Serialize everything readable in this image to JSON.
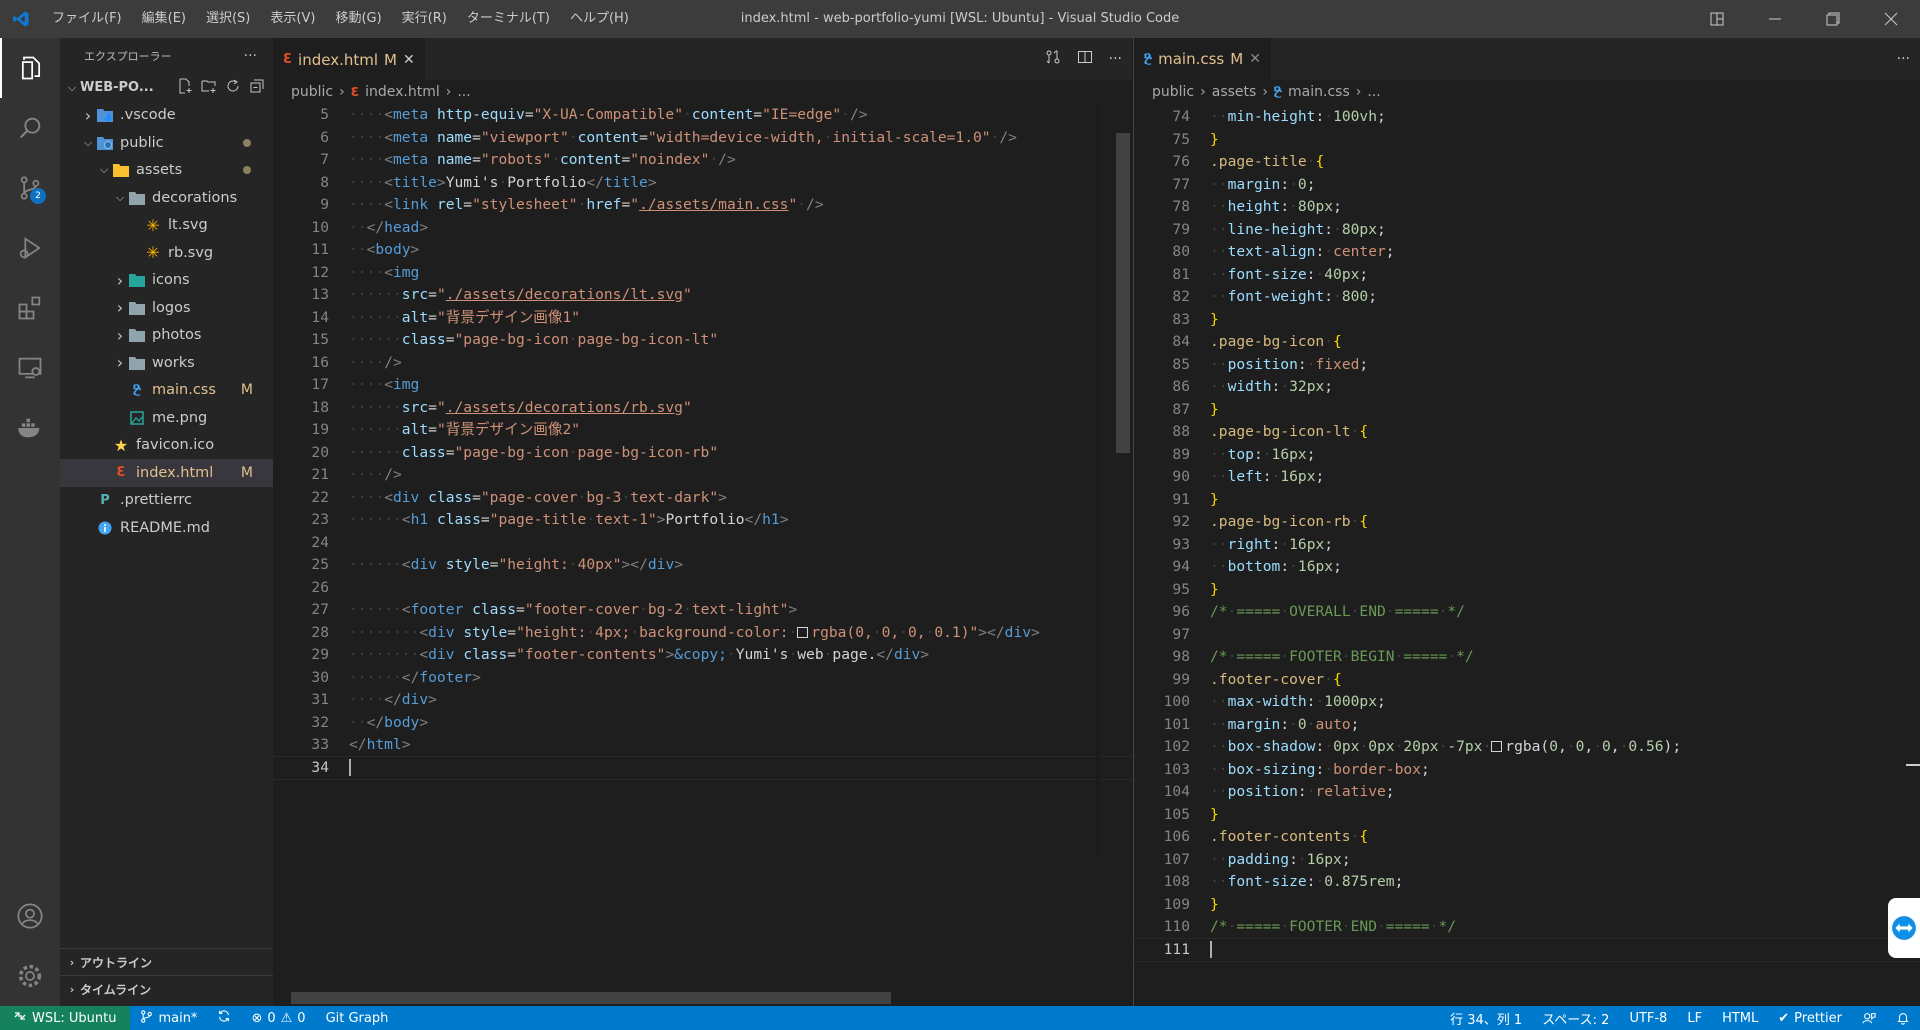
{
  "window": {
    "title": "index.html - web-portfolio-yumi [WSL: Ubuntu] - Visual Studio Code",
    "menu": [
      "ファイル(F)",
      "編集(E)",
      "選択(S)",
      "表示(V)",
      "移動(G)",
      "実行(R)",
      "ターミナル(T)",
      "ヘルプ(H)"
    ]
  },
  "activity": {
    "scm_badge": "2"
  },
  "sidebar": {
    "title": "エクスプローラー",
    "more": "···",
    "root": "WEB-PO...",
    "items": [
      {
        "label": ".vscode",
        "kind": "folder-vscode",
        "depth": 1,
        "chevron": "right"
      },
      {
        "label": "public",
        "kind": "folder-public",
        "depth": 1,
        "chevron": "down",
        "dot": true
      },
      {
        "label": "assets",
        "kind": "folder-assets",
        "depth": 2,
        "chevron": "down",
        "dot": true
      },
      {
        "label": "decorations",
        "kind": "folder",
        "depth": 3,
        "chevron": "down"
      },
      {
        "label": "lt.svg",
        "kind": "svg",
        "depth": 4
      },
      {
        "label": "rb.svg",
        "kind": "svg",
        "depth": 4
      },
      {
        "label": "icons",
        "kind": "folder-icons",
        "depth": 3,
        "chevron": "right"
      },
      {
        "label": "logos",
        "kind": "folder",
        "depth": 3,
        "chevron": "right"
      },
      {
        "label": "photos",
        "kind": "folder",
        "depth": 3,
        "chevron": "right"
      },
      {
        "label": "works",
        "kind": "folder",
        "depth": 3,
        "chevron": "right"
      },
      {
        "label": "main.css",
        "kind": "css",
        "depth": 3,
        "flag": "M"
      },
      {
        "label": "me.png",
        "kind": "png",
        "depth": 3
      },
      {
        "label": "favicon.ico",
        "kind": "ico",
        "depth": 2
      },
      {
        "label": "index.html",
        "kind": "html",
        "depth": 2,
        "flag": "M",
        "selected": true
      },
      {
        "label": ".prettierrc",
        "kind": "prettier",
        "depth": 1
      },
      {
        "label": "README.md",
        "kind": "info",
        "depth": 1
      }
    ],
    "outline": "アウトライン",
    "timeline": "タイムライン"
  },
  "left_editor": {
    "tab": {
      "name": "index.html",
      "flag": "M",
      "close": "✕"
    },
    "crumbs": [
      "public",
      "index.html",
      "..."
    ],
    "lines": [
      {
        "n": "5",
        "h": "····<t><meta</t> <a>http-equiv</a>=<s>\"X-UA-Compatible\"</s>·<a>content</a>=<s>\"IE=edge\"</s>·<t>/></t>"
      },
      {
        "n": "6",
        "h": "····<t><meta</t> <a>name</a>=<s>\"viewport\"</s>·<a>content</a>=<s>\"width=device-width,·initial-scale=1.0\"</s>·<t>/></t>"
      },
      {
        "n": "7",
        "h": "····<t><meta</t> <a>name</a>=<s>\"robots\"</s>·<a>content</a>=<s>\"noindex\"</s>·<t>/></t>"
      },
      {
        "n": "8",
        "h": "····<t><title></t>Yumi's·Portfolio<t></title></t>"
      },
      {
        "n": "9",
        "h": "····<t><link</t> <a>rel</a>=<s>\"stylesheet\"</s>·<a>href</a>=<s>\"<u>./assets/main.css</u>\"</s>·<t>/></t>"
      },
      {
        "n": "10",
        "h": "··<t></head></t>"
      },
      {
        "n": "11",
        "h": "··<t><body></t>"
      },
      {
        "n": "12",
        "h": "····<t><img</t>"
      },
      {
        "n": "13",
        "h": "······<a>src</a>=<s>\"<u>./assets/decorations/lt.svg</u>\"</s>"
      },
      {
        "n": "14",
        "h": "······<a>alt</a>=<s>\"背景デザイン画像1\"</s>"
      },
      {
        "n": "15",
        "h": "······<a>class</a>=<s>\"page-bg-icon·page-bg-icon-lt\"</s>"
      },
      {
        "n": "16",
        "h": "····<t>/></t>"
      },
      {
        "n": "17",
        "h": "····<t><img</t>"
      },
      {
        "n": "18",
        "h": "······<a>src</a>=<s>\"<u>./assets/decorations/rb.svg</u>\"</s>"
      },
      {
        "n": "19",
        "h": "······<a>alt</a>=<s>\"背景デザイン画像2\"</s>"
      },
      {
        "n": "20",
        "h": "······<a>class</a>=<s>\"page-bg-icon·page-bg-icon-rb\"</s>"
      },
      {
        "n": "21",
        "h": "····<t>/></t>"
      },
      {
        "n": "22",
        "h": "····<t><div</t> <a>class</a>=<s>\"page-cover·bg-3·text-dark\"</s><t>></t>"
      },
      {
        "n": "23",
        "h": "······<t><h1</t> <a>class</a>=<s>\"page-title·text-1\"</s><t>></t>Portfolio<t></h1></t>"
      },
      {
        "n": "24",
        "h": ""
      },
      {
        "n": "25",
        "h": "······<t><div</t> <a>style</a>=<s>\"height:·40px\"</s><t>></div></t>"
      },
      {
        "n": "26",
        "h": ""
      },
      {
        "n": "27",
        "h": "······<t><footer</t> <a>class</a>=<s>\"footer-cover·bg-2·text-light\"</s><t>></t>"
      },
      {
        "n": "28",
        "h": "········<t><div</t> <a>style</a>=<s>\"height:·4px;·background-color:·<sw></sw>rgba(0,·0,·0,·0.1)\"</s><t>></div></t>"
      },
      {
        "n": "29",
        "h": "········<t><div</t> <a>class</a>=<s>\"footer-contents\"</s><t>></t><e>&amp;copy;</e>·Yumi's·web·page.<t></div></t>"
      },
      {
        "n": "30",
        "h": "······<t></footer></t>"
      },
      {
        "n": "31",
        "h": "····<t></div></t>"
      },
      {
        "n": "32",
        "h": "··<t></body></t>"
      },
      {
        "n": "33",
        "h": "<t></html></t>"
      },
      {
        "n": "34",
        "h": "",
        "current": true
      }
    ]
  },
  "right_editor": {
    "tab": {
      "name": "main.css",
      "flag": "M",
      "close": "✕"
    },
    "crumbs": [
      "public",
      "assets",
      "main.css",
      "..."
    ],
    "lines": [
      {
        "n": "74",
        "h": "··<p>min-height</p>:·<n>100vh</n>;"
      },
      {
        "n": "75",
        "h": "<b>}</b>"
      },
      {
        "n": "76",
        "h": "<c>.page-title</c>·<b>{</b>"
      },
      {
        "n": "77",
        "h": "··<p>margin</p>:·<n>0</n>;"
      },
      {
        "n": "78",
        "h": "··<p>height</p>:·<n>80px</n>;"
      },
      {
        "n": "79",
        "h": "··<p>line-height</p>:·<n>80px</n>;"
      },
      {
        "n": "80",
        "h": "··<p>text-align</p>:·<s>center</s>;"
      },
      {
        "n": "81",
        "h": "··<p>font-size</p>:·<n>40px</n>;"
      },
      {
        "n": "82",
        "h": "··<p>font-weight</p>:·<n>800</n>;"
      },
      {
        "n": "83",
        "h": "<b>}</b>"
      },
      {
        "n": "84",
        "h": "<c>.page-bg-icon</c>·<b>{</b>"
      },
      {
        "n": "85",
        "h": "··<p>position</p>:·<s>fixed</s>;"
      },
      {
        "n": "86",
        "h": "··<p>width</p>:·<n>32px</n>;"
      },
      {
        "n": "87",
        "h": "<b>}</b>"
      },
      {
        "n": "88",
        "h": "<c>.page-bg-icon-lt</c>·<b>{</b>"
      },
      {
        "n": "89",
        "h": "··<p>top</p>:·<n>16px</n>;"
      },
      {
        "n": "90",
        "h": "··<p>left</p>:·<n>16px</n>;"
      },
      {
        "n": "91",
        "h": "<b>}</b>"
      },
      {
        "n": "92",
        "h": "<c>.page-bg-icon-rb</c>·<b>{</b>"
      },
      {
        "n": "93",
        "h": "··<p>right</p>:·<n>16px</n>;"
      },
      {
        "n": "94",
        "h": "··<p>bottom</p>:·<n>16px</n>;"
      },
      {
        "n": "95",
        "h": "<b>}</b>"
      },
      {
        "n": "96",
        "h": "<m>/*·=====·OVERALL·END·=====·*/</m>"
      },
      {
        "n": "97",
        "h": ""
      },
      {
        "n": "98",
        "h": "<m>/*·=====·FOOTER·BEGIN·=====·*/</m>"
      },
      {
        "n": "99",
        "h": "<c>.footer-cover</c>·<b>{</b>"
      },
      {
        "n": "100",
        "h": "··<p>max-width</p>:·<n>1000px</n>;"
      },
      {
        "n": "101",
        "h": "··<p>margin</p>:·<n>0</n>·<s>auto</s>;"
      },
      {
        "n": "102",
        "h": "··<p>box-shadow</p>:·<n>0px</n>·<n>0px</n>·<n>20px</n>·<n>-7px</n>·<sw></sw>rgba(<n>0</n>,·<n>0</n>,·<n>0</n>,·<n>0.56</n>);"
      },
      {
        "n": "103",
        "h": "··<p>box-sizing</p>:·<s>border-box</s>;"
      },
      {
        "n": "104",
        "h": "··<p>position</p>:·<s>relative</s>;"
      },
      {
        "n": "105",
        "h": "<b>}</b>"
      },
      {
        "n": "106",
        "h": "<c>.footer-contents</c>·<b>{</b>"
      },
      {
        "n": "107",
        "h": "··<p>padding</p>:·<n>16px</n>;"
      },
      {
        "n": "108",
        "h": "··<p>font-size</p>:·<n>0.875rem</n>;"
      },
      {
        "n": "109",
        "h": "<b>}</b>"
      },
      {
        "n": "110",
        "h": "<m>/*·=====·FOOTER·END·=====·*/</m>"
      },
      {
        "n": "111",
        "h": "",
        "current": true
      }
    ]
  },
  "statusbar": {
    "remote": "WSL: Ubuntu",
    "branch": "main*",
    "errors": "0",
    "warnings": "0",
    "gitgraph": "Git Graph",
    "position": "行 34、列 1",
    "spaces": "スペース: 2",
    "encoding": "UTF-8",
    "eol": "LF",
    "language": "HTML",
    "prettier": "Prettier"
  }
}
